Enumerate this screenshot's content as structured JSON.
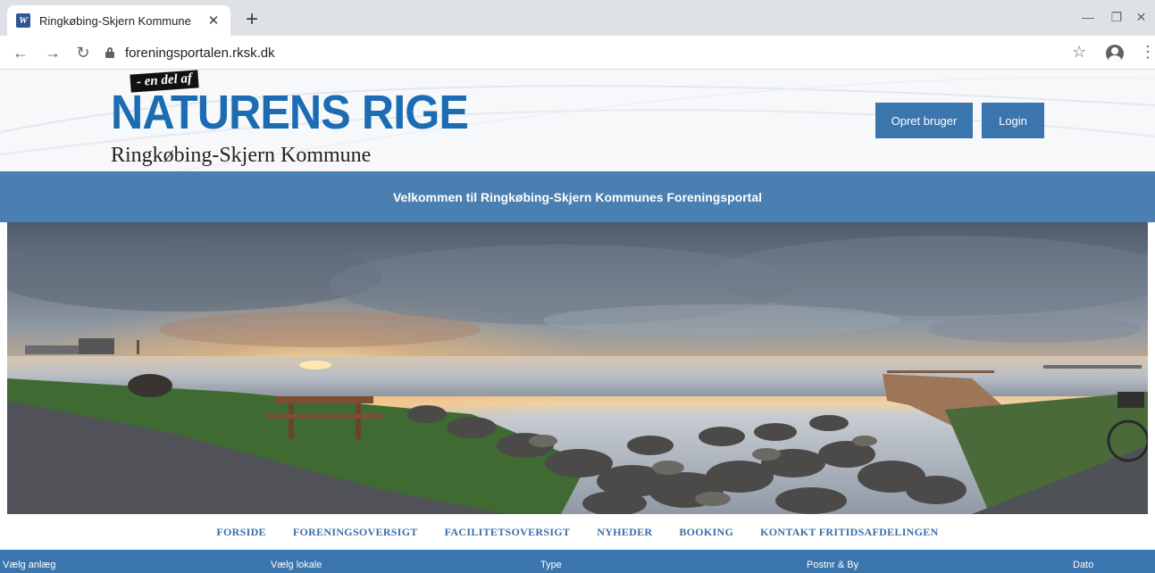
{
  "browser": {
    "tab_title": "Ringkøbing-Skjern Kommune",
    "favicon_letter": "W",
    "url": "foreningsportalen.rksk.dk"
  },
  "header": {
    "logo_tag": "- en del af",
    "logo_main": "NATURENS RIGE",
    "logo_sub": "Ringkøbing-Skjern Kommune",
    "register_label": "Opret bruger",
    "login_label": "Login"
  },
  "welcome_text": "Velkommen til Ringkøbing-Skjern Kommunes Foreningsportal",
  "nav": {
    "items": [
      "FORSIDE",
      "FORENINGSOVERSIGT",
      "FACILITETSOVERSIGT",
      "NYHEDER",
      "BOOKING",
      "KONTAKT FRITIDSAFDELINGEN"
    ]
  },
  "filters": {
    "facility": "Vælg anlæg",
    "room": "Vælg lokale",
    "type": "Type",
    "postal": "Postnr & By",
    "date": "Dato"
  },
  "colors": {
    "brand_blue": "#3b75ad",
    "logo_blue": "#1b6cb3"
  }
}
